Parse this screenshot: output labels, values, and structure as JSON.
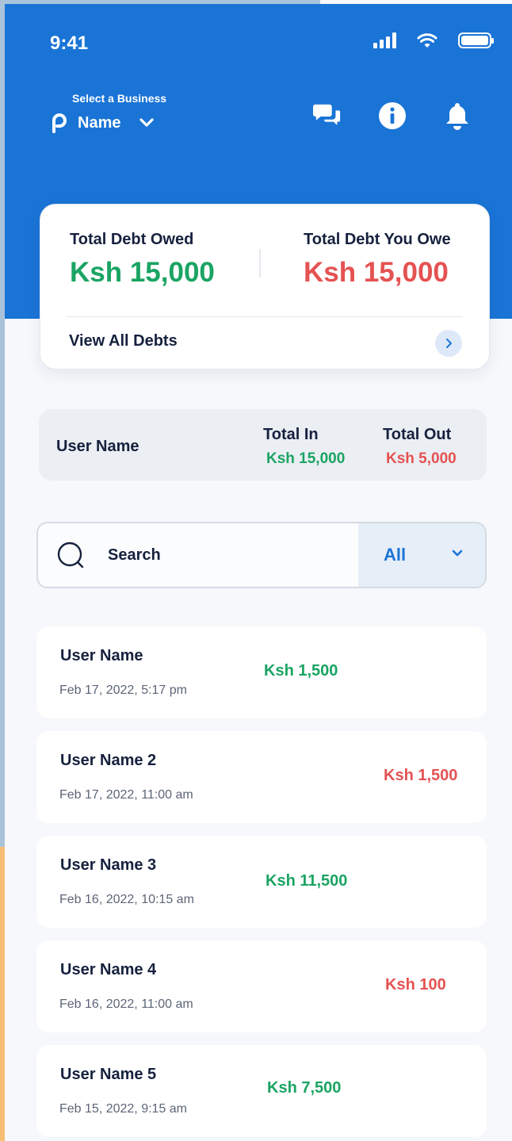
{
  "status_bar": {
    "time": "9:41"
  },
  "header": {
    "select_label": "Select a Business",
    "business_name": "Name"
  },
  "debt_card": {
    "owed_label": "Total Debt Owed",
    "owed_value": "Ksh 15,000",
    "you_owe_label": "Total Debt You Owe",
    "you_owe_value": "Ksh 15,000",
    "view_all_label": "View All Debts"
  },
  "summary": {
    "user_name": "User Name",
    "total_in_label": "Total In",
    "total_in_value": "Ksh 15,000",
    "total_out_label": "Total Out",
    "total_out_value": "Ksh 5,000"
  },
  "search": {
    "placeholder": "Search",
    "filter_value": "All"
  },
  "transactions": [
    {
      "name": "User Name",
      "date": "Feb 17, 2022, 5:17 pm",
      "amount": "Ksh 1,500",
      "direction": "in"
    },
    {
      "name": "User Name 2",
      "date": "Feb 17, 2022, 11:00 am",
      "amount": "Ksh 1,500",
      "direction": "out"
    },
    {
      "name": "User Name 3",
      "date": "Feb 16, 2022, 10:15 am",
      "amount": "Ksh 11,500",
      "direction": "in"
    },
    {
      "name": "User Name 4",
      "date": "Feb 16, 2022, 11:00 am",
      "amount": "Ksh 100",
      "direction": "out"
    },
    {
      "name": "User Name 5",
      "date": "Feb 15, 2022, 9:15 am",
      "amount": "Ksh 7,500",
      "direction": "in"
    }
  ],
  "colors": {
    "primary": "#1a74d6",
    "positive": "#1aa463",
    "negative": "#e55252"
  }
}
